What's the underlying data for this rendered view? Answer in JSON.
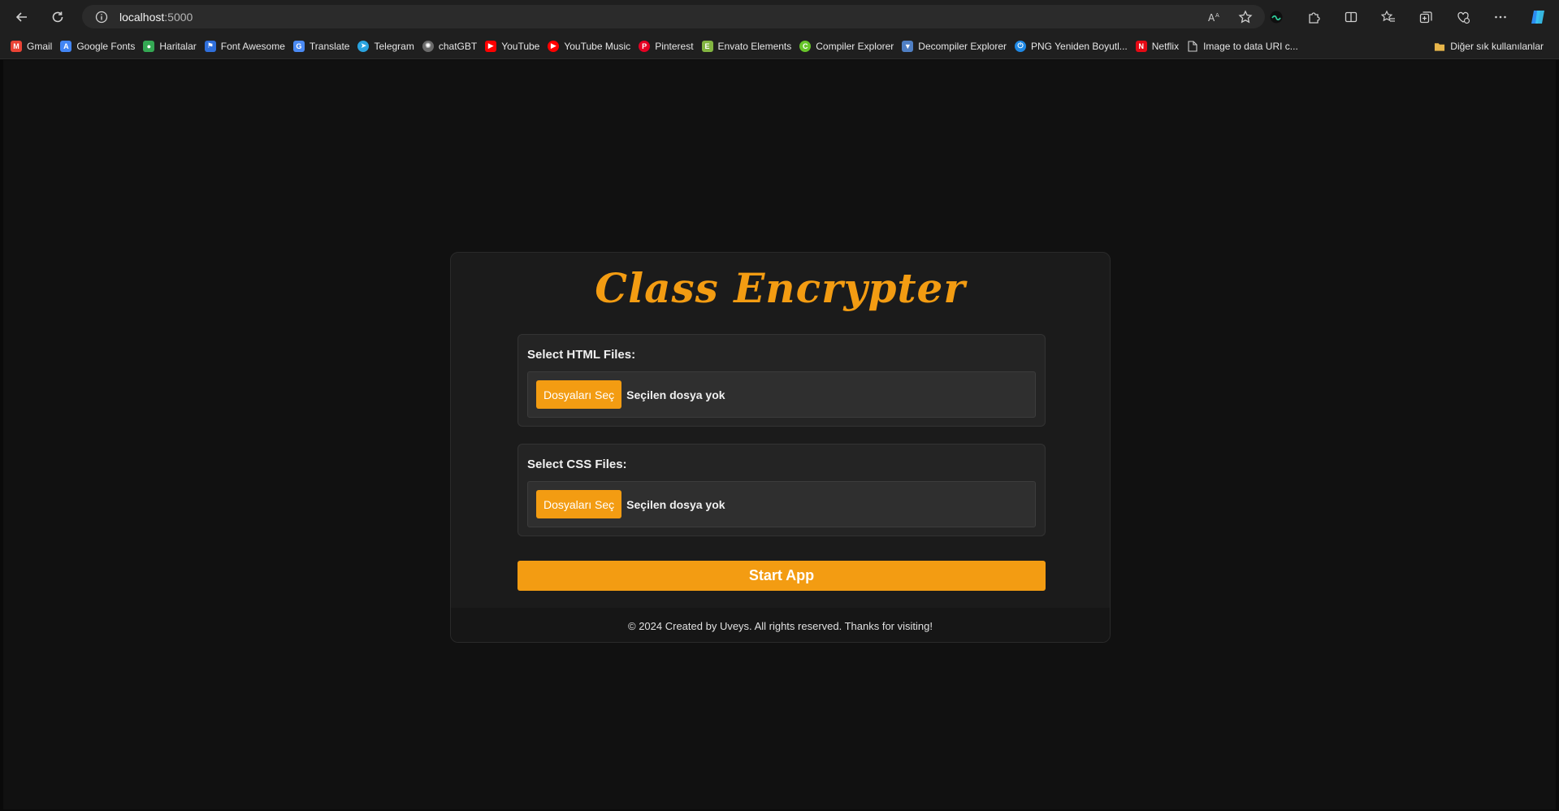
{
  "browser": {
    "url_host": "localhost",
    "url_port": ":5000"
  },
  "bookmarks": [
    {
      "label": "Gmail",
      "icon": "gmail-icon",
      "color": "#ea4335"
    },
    {
      "label": "Google Fonts",
      "icon": "google-fonts-icon",
      "color": "#4285f4"
    },
    {
      "label": "Haritalar",
      "icon": "maps-icon",
      "color": "#34a853"
    },
    {
      "label": "Font Awesome",
      "icon": "font-awesome-icon",
      "color": "#2f6fdb"
    },
    {
      "label": "Translate",
      "icon": "translate-icon",
      "color": "#4a8af4"
    },
    {
      "label": "Telegram",
      "icon": "telegram-icon",
      "color": "#2aa3df"
    },
    {
      "label": "chatGBT",
      "icon": "chatgpt-icon",
      "color": "#6b6b6b"
    },
    {
      "label": "YouTube",
      "icon": "youtube-icon",
      "color": "#ff0000"
    },
    {
      "label": "YouTube Music",
      "icon": "youtube-music-icon",
      "color": "#ff0000"
    },
    {
      "label": "Pinterest",
      "icon": "pinterest-icon",
      "color": "#e60023"
    },
    {
      "label": "Envato Elements",
      "icon": "envato-icon",
      "color": "#82b541"
    },
    {
      "label": "Compiler Explorer",
      "icon": "compiler-explorer-icon",
      "color": "#67c52a"
    },
    {
      "label": "Decompiler Explorer",
      "icon": "decompiler-explorer-icon",
      "color": "#4f7fc4"
    },
    {
      "label": "PNG Yeniden Boyutl...",
      "icon": "png-resize-icon",
      "color": "#1e88e5"
    },
    {
      "label": "Netflix",
      "icon": "netflix-icon",
      "color": "#e50914"
    },
    {
      "label": "Image to data URI c...",
      "icon": "page-icon",
      "color": "#cfcfcf"
    }
  ],
  "bookmarks_folder": "Diğer sık kullanılanlar",
  "app": {
    "title": "Class Encrypter",
    "html_label": "Select HTML Files:",
    "css_label": "Select CSS Files:",
    "file_button": "Dosyaları Seç",
    "file_status": "Seçilen dosya yok",
    "start_button": "Start App",
    "footer": "© 2024 Created by Uveys. All rights reserved. Thanks for visiting!",
    "accent": "#f39c12"
  }
}
